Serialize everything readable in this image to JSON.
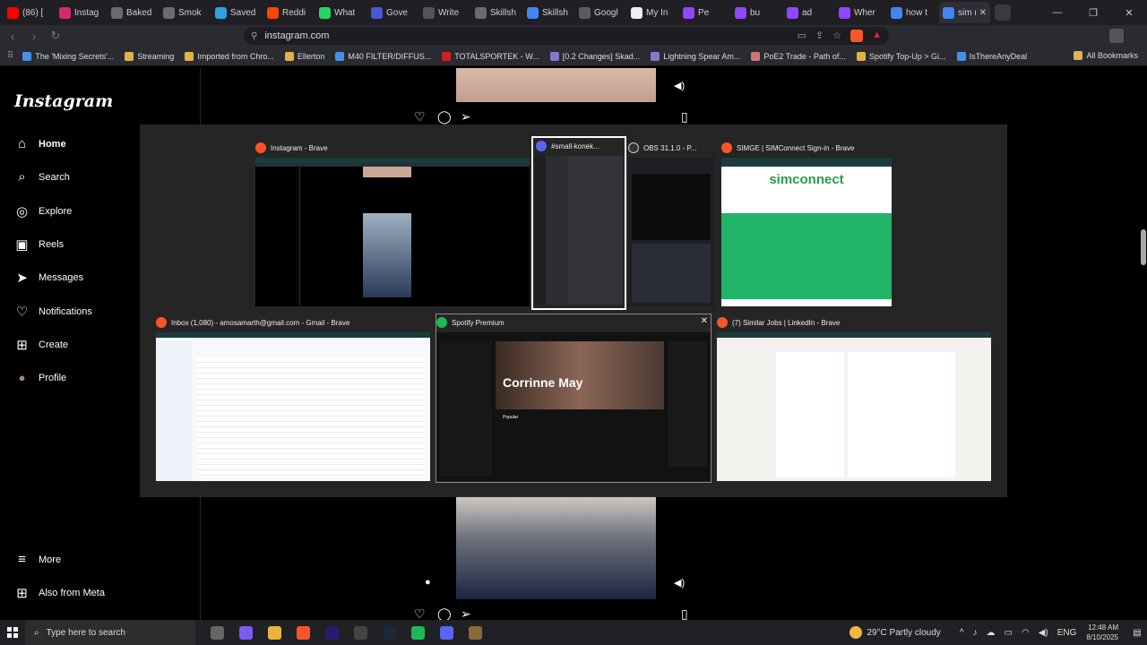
{
  "browser": {
    "tabs": [
      {
        "title": "(86) [",
        "color": "#ff0000"
      },
      {
        "title": "Instag",
        "color": "#d62976"
      },
      {
        "title": "Baked",
        "color": "#6a6a74"
      },
      {
        "title": "Smok",
        "color": "#6a6a74"
      },
      {
        "title": "Saved",
        "color": "#2aa3e0"
      },
      {
        "title": "Reddi",
        "color": "#ff4500"
      },
      {
        "title": "What",
        "color": "#25d366"
      },
      {
        "title": "Gove",
        "color": "#4a56d6"
      },
      {
        "title": "Write",
        "color": "#555"
      },
      {
        "title": "Skillsh",
        "color": "#6a6a74"
      },
      {
        "title": "Skillsh",
        "color": "#4285f4"
      },
      {
        "title": "Googl",
        "color": "#5b5b66"
      },
      {
        "title": "My In",
        "color": "#eee"
      },
      {
        "title": "Pe",
        "color": "#9146ff"
      },
      {
        "title": "bu",
        "color": "#9146ff"
      },
      {
        "title": "ad",
        "color": "#9146ff"
      },
      {
        "title": "Wher",
        "color": "#9146ff"
      },
      {
        "title": "how t",
        "color": "#4285f4"
      },
      {
        "title": "sim m",
        "color": "#4285f4"
      }
    ],
    "active_tab_close": "✕",
    "window_controls": [
      "—",
      "❐",
      "✕"
    ],
    "url": "instagram.com",
    "bookmarks": [
      {
        "label": "The 'Mixing Secrets'...",
        "color": "#4a8fe2"
      },
      {
        "label": "Streaming",
        "color": "#e0b34a"
      },
      {
        "label": "Imported from Chro...",
        "color": "#e0b34a"
      },
      {
        "label": "Ellerton",
        "color": "#e0b34a"
      },
      {
        "label": "M40 FILTER/DIFFUS...",
        "color": "#4a8fe2"
      },
      {
        "label": "TOTALSPORTEK - W...",
        "color": "#c22"
      },
      {
        "label": "[0.2 Changes] Skad...",
        "color": "#8877cc"
      },
      {
        "label": "Lightning Spear Am...",
        "color": "#8877cc"
      },
      {
        "label": "PoE2 Trade - Path of...",
        "color": "#c77"
      },
      {
        "label": "Spotify Top-Up > Gi...",
        "color": "#e0b34a"
      },
      {
        "label": "IsThereAnyDeal",
        "color": "#4a8fe2"
      }
    ],
    "all_bookmarks": "All Bookmarks"
  },
  "instagram": {
    "logo": "Instagram",
    "nav": [
      {
        "label": "Home",
        "icon": "home-icon",
        "glyph": "⌂"
      },
      {
        "label": "Search",
        "icon": "search-icon",
        "glyph": "⌕"
      },
      {
        "label": "Explore",
        "icon": "compass-icon",
        "glyph": "◎"
      },
      {
        "label": "Reels",
        "icon": "reels-icon",
        "glyph": "▣"
      },
      {
        "label": "Messages",
        "icon": "send-icon",
        "glyph": "➤"
      },
      {
        "label": "Notifications",
        "icon": "heart-icon",
        "glyph": "♡"
      },
      {
        "label": "Create",
        "icon": "plus-square-icon",
        "glyph": "⊞"
      },
      {
        "label": "Profile",
        "icon": "avatar-icon",
        "glyph": "●"
      }
    ],
    "more": "More",
    "meta": "Also from Meta"
  },
  "switcher": {
    "windows": [
      {
        "title": "Instagram - Brave",
        "icon_color": "#fb542b"
      },
      {
        "title": "#small-konek...",
        "icon_color": "#5865f2"
      },
      {
        "title": "OBS 31.1.0 - P...",
        "icon_color": "#333"
      },
      {
        "title": "SIMGE | SIMConnect Sign-in - Brave",
        "icon_color": "#fb542b"
      },
      {
        "title": "Inbox (1,080) - amosamarth@gmail.com - Gmail - Brave",
        "icon_color": "#fb542b"
      },
      {
        "title": "Spotify Premium",
        "icon_color": "#1db954"
      },
      {
        "title": "(7) Similar Jobs | LinkedIn - Brave",
        "icon_color": "#fb542b"
      }
    ],
    "close": "✕",
    "spotify_artist": "Corrinne May",
    "spotify_popular": "Popular",
    "simconnect_logo": "simconnect"
  },
  "taskbar": {
    "search_placeholder": "Type here to search",
    "weather": "29°C  Partly cloudy",
    "lang": "ENG",
    "time": "12:48 AM",
    "date": "8/10/2025",
    "icons": [
      {
        "name": "task-view-icon",
        "color": "#666"
      },
      {
        "name": "copilot-icon",
        "color": "#7a5cf0"
      },
      {
        "name": "file-explorer-icon",
        "color": "#e8b53a"
      },
      {
        "name": "brave-icon",
        "color": "#fb542b"
      },
      {
        "name": "premiere-icon",
        "color": "#2a1a6e"
      },
      {
        "name": "obs-icon",
        "color": "#444"
      },
      {
        "name": "steam-icon",
        "color": "#1b2838"
      },
      {
        "name": "spotify-icon",
        "color": "#1db954"
      },
      {
        "name": "discord-icon",
        "color": "#5865f2"
      },
      {
        "name": "app-icon",
        "color": "#8a6a3a"
      }
    ]
  }
}
